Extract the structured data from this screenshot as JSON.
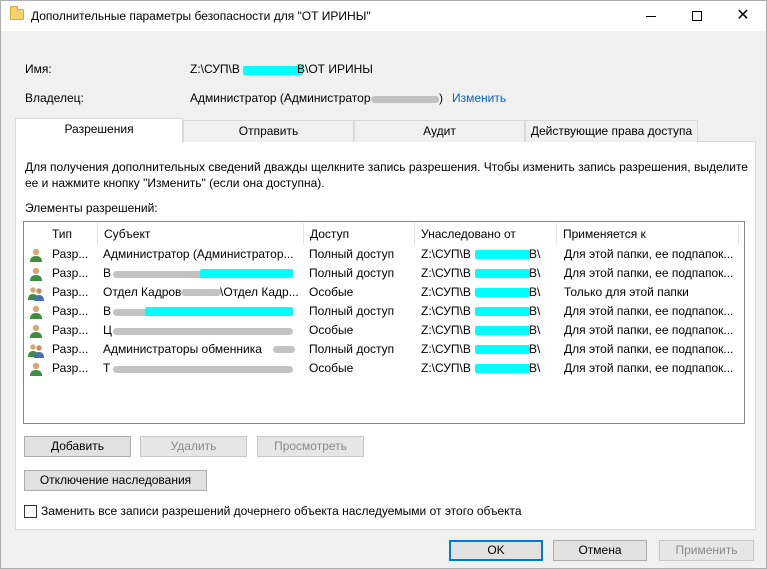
{
  "window": {
    "title": "Дополнительные параметры безопасности  для \"ОТ ИРИНЫ\"",
    "close_glyph": "✕"
  },
  "info": {
    "name_label": "Имя:",
    "name_prefix": "Z:\\СУП\\В",
    "name_suffix": "В\\ОТ ИРИНЫ",
    "owner_label": "Владелец:",
    "owner_value": "Администратор (Администратор",
    "owner_tail": ")",
    "change_link": "Изменить"
  },
  "tabs": [
    {
      "label": "Разрешения",
      "active": true
    },
    {
      "label": "Отправить",
      "active": false
    },
    {
      "label": "Аудит",
      "active": false
    },
    {
      "label": "Действующие права доступа",
      "active": false
    }
  ],
  "permissions": {
    "description_line1": "Для получения дополнительных сведений дважды щелкните запись разрешения. Чтобы изменить запись разрешения, выделите",
    "description_line2": "ее и нажмите кнопку \"Изменить\" (если она доступна).",
    "list_label": "Элементы разрешений:",
    "columns": [
      "Тип",
      "Субъект",
      "Доступ",
      "Унаследовано от",
      "Применяется к"
    ],
    "rows": [
      {
        "icon": "user-icon",
        "type": "Разр...",
        "subject": "Администратор (Администратор...",
        "access": "Полный доступ",
        "inherited": "Z:\\СУП\\В",
        "inherited_tail": "В\\",
        "applies": "Для этой папки, ее подпапок..."
      },
      {
        "icon": "user-icon",
        "type": "Разр...",
        "subject": "В",
        "access": "Полный доступ",
        "inherited": "Z:\\СУП\\В",
        "inherited_tail": "В\\",
        "applies": "Для этой папки, ее подпапок..."
      },
      {
        "icon": "group-icon",
        "type": "Разр...",
        "subject": "Отдел Кадров",
        "subject_tail": "\\Отдел Кадр...",
        "access": "Особые",
        "inherited": "Z:\\СУП\\В",
        "inherited_tail": "В\\",
        "applies": "Только для этой папки"
      },
      {
        "icon": "user-icon",
        "type": "Разр...",
        "subject": "В",
        "access": "Полный доступ",
        "inherited": "Z:\\СУП\\В",
        "inherited_tail": "В\\",
        "applies": "Для этой папки, ее подпапок..."
      },
      {
        "icon": "user-icon",
        "type": "Разр...",
        "subject": "Ц",
        "access": "Особые",
        "inherited": "Z:\\СУП\\В",
        "inherited_tail": "В\\",
        "applies": "Для этой папки, ее подпапок..."
      },
      {
        "icon": "group-icon",
        "type": "Разр...",
        "subject": "Администраторы обменника",
        "access": "Полный доступ",
        "inherited": "Z:\\СУП\\В",
        "inherited_tail": "В\\",
        "applies": "Для этой папки, ее подпапок..."
      },
      {
        "icon": "user-icon",
        "type": "Разр...",
        "subject": "Т",
        "access": "Особые",
        "inherited": "Z:\\СУП\\В",
        "inherited_tail": "В\\",
        "applies": "Для этой папки, ее подпапок..."
      }
    ],
    "add_label": "Добавить",
    "remove_label": "Удалить",
    "view_label": "Просмотреть",
    "disable_inheritance_label": "Отключение наследования",
    "replace_checkbox_label": "Заменить все записи разрешений дочернего объекта наследуемыми от этого объекта"
  },
  "footer": {
    "ok_label": "OK",
    "cancel_label": "Отмена",
    "apply_label": "Применить"
  },
  "colors": {
    "redaction_cyan": "#00ffff",
    "link": "#0066cc",
    "focus_border": "#0078d7"
  }
}
